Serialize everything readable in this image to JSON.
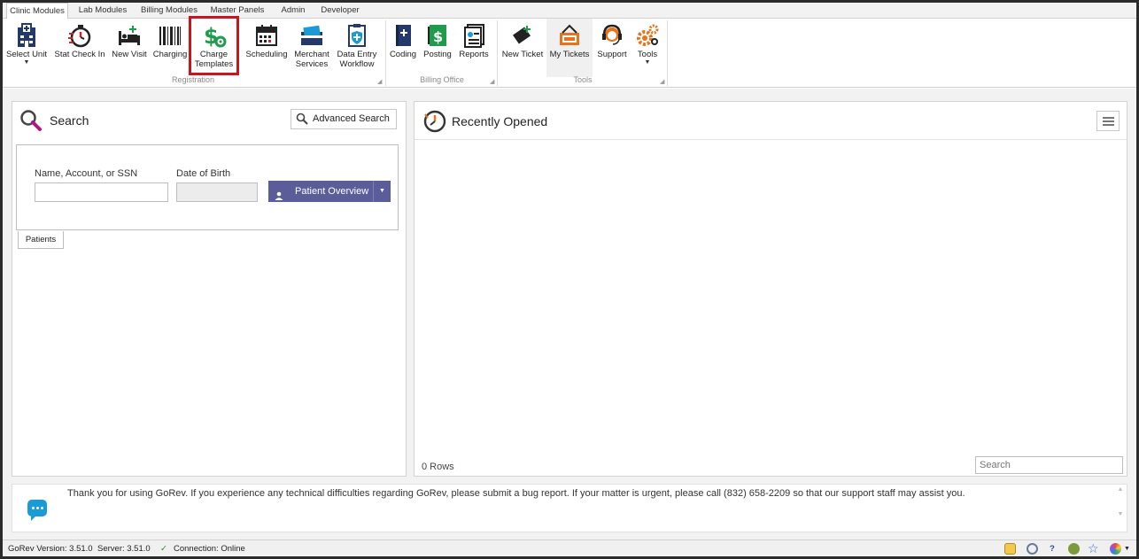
{
  "ribbon": {
    "tabs": [
      "Clinic Modules",
      "Lab Modules",
      "Billing Modules",
      "Master Panels",
      "Admin",
      "Developer"
    ],
    "buttons": {
      "select_unit": "Select Unit",
      "stat_check_in": "Stat Check In",
      "new_visit": "New Visit",
      "charging": "Charging",
      "charge_templates_1": "Charge",
      "charge_templates_2": "Templates",
      "scheduling": "Scheduling",
      "merchant_services_1": "Merchant",
      "merchant_services_2": "Services",
      "data_entry_1": "Data Entry",
      "data_entry_2": "Workflow",
      "coding": "Coding",
      "posting": "Posting",
      "reports": "Reports",
      "new_ticket": "New Ticket",
      "my_tickets": "My Tickets",
      "support": "Support",
      "tools": "Tools"
    },
    "groups": {
      "registration": "Registration",
      "billing_office": "Billing Office",
      "tools": "Tools"
    }
  },
  "search_panel": {
    "title": "Search",
    "advanced_search": "Advanced Search",
    "name_label": "Name, Account, or SSN",
    "dob_label": "Date of Birth",
    "name_value": "",
    "dob_value": "",
    "patient_overview": "Patient Overview",
    "tab_label": "Patients"
  },
  "recent_panel": {
    "title": "Recently Opened",
    "rows": "0 Rows",
    "search_placeholder": "Search"
  },
  "message": {
    "text": "Thank you for using GoRev.  If you experience any technical difficulties regarding GoRev, please submit a bug report.  If your matter is urgent, please call (832) 658-2209 so that our support staff may assist you."
  },
  "status": {
    "version": "GoRev Version: 3.51.0",
    "server": "Server: 3.51.0",
    "connection": "Connection: Online"
  },
  "colors": {
    "accent": "#5b5d9b",
    "highlight": "#c8161d",
    "green": "#1e9b4b",
    "orange": "#e8731c",
    "navy": "#24396b",
    "blue": "#1a9ad6"
  }
}
